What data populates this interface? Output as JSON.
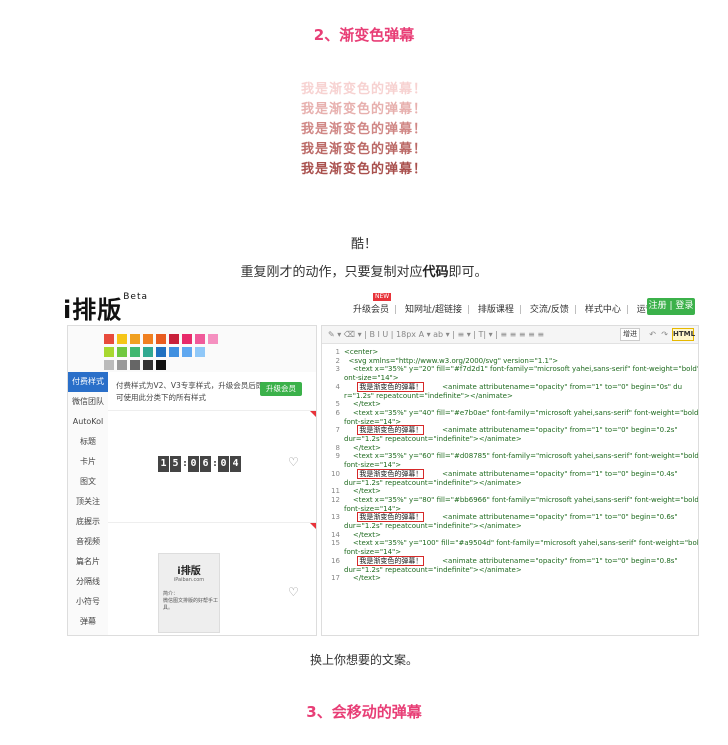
{
  "section2": {
    "heading": "2、渐变色弹幕"
  },
  "barrage": {
    "text": "我是渐变色的弹幕！",
    "colors": [
      "#f7d2d1",
      "#e7b0ae",
      "#d08785",
      "#bb6966",
      "#a9504d"
    ]
  },
  "intro": {
    "line1": "酷！",
    "line2_prefix": "重复刚才的动作，只要复制对应",
    "line2_bold": "代码",
    "line2_suffix": "即可。"
  },
  "app": {
    "logo": "i排版",
    "logo_sup": "Beta",
    "nav": {
      "badge": "NEW",
      "items": [
        "升级会员",
        "知网址/超链接",
        "排版课程",
        "交流/反馈",
        "样式中心",
        "运营/排版指南"
      ],
      "register": "注册 | 登录"
    },
    "sidebar": [
      "付费样式",
      "微信团队",
      "AutoKol",
      "标题",
      "卡片",
      "图文",
      "顶关注",
      "底握示",
      "音视频",
      "篇名片",
      "分隔线",
      "小符号",
      "弹幕"
    ],
    "promo_text": "付费样式为V2、V3专享样式，升级会员后即可使用此分类下的所有样式",
    "upgrade_label": "升级会员",
    "counter": [
      "1",
      "5",
      ":",
      "0",
      "6",
      ":",
      "0",
      "4"
    ],
    "bookcard": {
      "title": "i排版",
      "url": "iPaiban.com",
      "intro_title": "简介：",
      "intro_text": "微信图文排版的好帮手工具。"
    },
    "editor": {
      "toolbar_left": "✎ ▾  ⌫ ▾ | B I U | 18px  A ▾  ab ▾ | ≡ ▾ | T| ▾ | ≡ ≡ ≡ ≡ ≡",
      "increase_label": "增进",
      "html_label": "HTML",
      "lines": [
        {
          "n": "1",
          "pre": "<center>",
          "boxed": "",
          "post": ""
        },
        {
          "n": "2",
          "pre": "  <svg xmlns=\"http://www.w3.org/2000/svg\" version=\"1.1\">",
          "boxed": "",
          "post": ""
        },
        {
          "n": "3",
          "pre": "    <text x=\"35%\" y=\"20\" fill=\"#f7d2d1\" font-family=\"microsoft yahei,sans-serif\" font-weight=\"bold\" f",
          "boxed": "",
          "post": ""
        },
        {
          "n": "",
          "pre": "ont-size=\"14\">",
          "boxed": "",
          "post": ""
        },
        {
          "n": "4",
          "pre": "      ",
          "boxed": "我是渐变色的弹幕！",
          "post": "        <animate attributename=\"opacity\" from=\"1\" to=\"0\" begin=\"0s\" du"
        },
        {
          "n": "",
          "pre": "r=\"1.2s\" repeatcount=\"indefinite\"></animate>",
          "boxed": "",
          "post": ""
        },
        {
          "n": "5",
          "pre": "    </text>",
          "boxed": "",
          "post": ""
        },
        {
          "n": "6",
          "pre": "    <text x=\"35%\" y=\"40\" fill=\"#e7b0ae\" font-family=\"microsoft yahei,sans-serif\" font-weight=\"bold\"",
          "boxed": "",
          "post": ""
        },
        {
          "n": "",
          "pre": "font-size=\"14\">",
          "boxed": "",
          "post": ""
        },
        {
          "n": "7",
          "pre": "      ",
          "boxed": "我是渐变色的弹幕！",
          "post": "        <animate attributename=\"opacity\" from=\"1\" to=\"0\" begin=\"0.2s\""
        },
        {
          "n": "",
          "pre": "dur=\"1.2s\" repeatcount=\"indefinite\"></animate>",
          "boxed": "",
          "post": ""
        },
        {
          "n": "8",
          "pre": "    </text>",
          "boxed": "",
          "post": ""
        },
        {
          "n": "9",
          "pre": "    <text x=\"35%\" y=\"60\" fill=\"#d08785\" font-family=\"microsoft yahei,sans-serif\" font-weight=\"bold\"",
          "boxed": "",
          "post": ""
        },
        {
          "n": "",
          "pre": "font-size=\"14\">",
          "boxed": "",
          "post": ""
        },
        {
          "n": "10",
          "pre": "      ",
          "boxed": "我是渐变色的弹幕！",
          "post": "        <animate attributename=\"opacity\" from=\"1\" to=\"0\" begin=\"0.4s\""
        },
        {
          "n": "",
          "pre": "dur=\"1.2s\" repeatcount=\"indefinite\"></animate>",
          "boxed": "",
          "post": ""
        },
        {
          "n": "11",
          "pre": "    </text>",
          "boxed": "",
          "post": ""
        },
        {
          "n": "12",
          "pre": "    <text x=\"35%\" y=\"80\" fill=\"#bb6966\" font-family=\"microsoft yahei,sans-serif\" font-weight=\"bold\"",
          "boxed": "",
          "post": ""
        },
        {
          "n": "",
          "pre": "font-size=\"14\">",
          "boxed": "",
          "post": ""
        },
        {
          "n": "13",
          "pre": "      ",
          "boxed": "我是渐变色的弹幕！",
          "post": "        <animate attributename=\"opacity\" from=\"1\" to=\"0\" begin=\"0.6s\""
        },
        {
          "n": "",
          "pre": "dur=\"1.2s\" repeatcount=\"indefinite\"></animate>",
          "boxed": "",
          "post": ""
        },
        {
          "n": "14",
          "pre": "    </text>",
          "boxed": "",
          "post": ""
        },
        {
          "n": "15",
          "pre": "    <text x=\"35%\" y=\"100\" fill=\"#a9504d\" font-family=\"microsoft yahei,sans-serif\" font-weight=\"bold\"",
          "boxed": "",
          "post": ""
        },
        {
          "n": "",
          "pre": "font-size=\"14\">",
          "boxed": "",
          "post": ""
        },
        {
          "n": "16",
          "pre": "      ",
          "boxed": "我是渐变色的弹幕！",
          "post": "        <animate attributename=\"opacity\" from=\"1\" to=\"0\" begin=\"0.8s\""
        },
        {
          "n": "",
          "pre": "dur=\"1.2s\" repeatcount=\"indefinite\"></animate>",
          "boxed": "",
          "post": ""
        },
        {
          "n": "17",
          "pre": "    </text>",
          "boxed": "",
          "post": ""
        }
      ]
    },
    "swatch_colors": [
      "#e84b3c",
      "#f5c518",
      "#f0a020",
      "#f08020",
      "#e85c20",
      "#c8203a",
      "#e82a6a",
      "#f05a9a",
      "#f590c0",
      "#a8d830",
      "#70c840",
      "#40b870",
      "#30a890",
      "#2070c0",
      "#4090e0",
      "#60a8f0",
      "#90c8f8",
      "#bbbbbb",
      "#999999",
      "#666666",
      "#333333",
      "#111111"
    ]
  },
  "caption": "换上你想要的文案。",
  "section3": {
    "heading": "3、会移动的弹幕"
  }
}
